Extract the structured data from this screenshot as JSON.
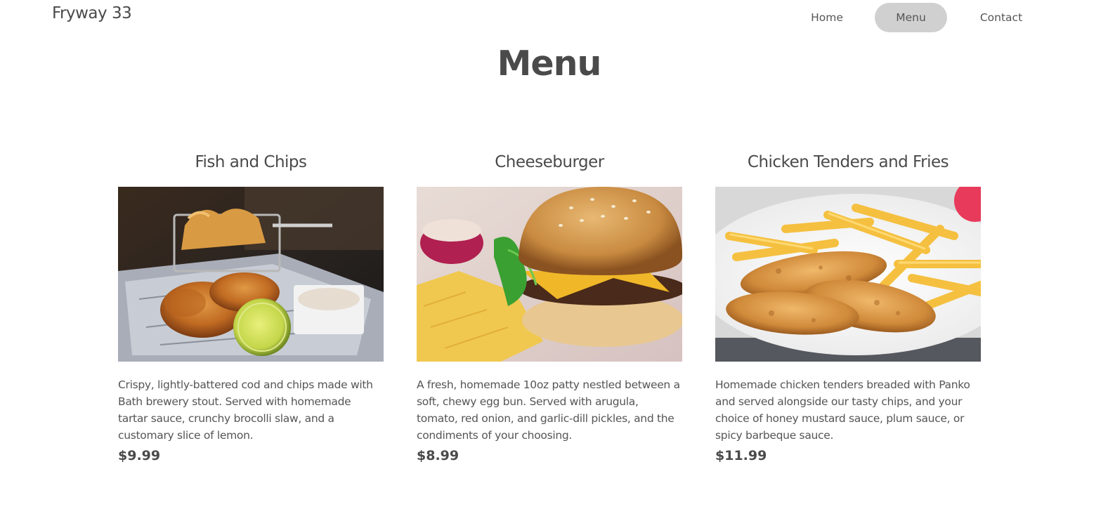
{
  "header": {
    "brand": "Fryway 33",
    "nav": [
      {
        "label": "Home",
        "active": false
      },
      {
        "label": "Menu",
        "active": true
      },
      {
        "label": "Contact",
        "active": false
      }
    ]
  },
  "page": {
    "title": "Menu"
  },
  "menu_items": [
    {
      "name": "Fish and Chips",
      "image": "fish-and-chips-photo",
      "description": "Crispy, lightly-battered cod and chips made with Bath brewery stout. Served with homemade tartar sauce, crunchy brocolli slaw, and a customary slice of lemon.",
      "price": "$9.99"
    },
    {
      "name": "Cheeseburger",
      "image": "cheeseburger-photo",
      "description": "A fresh, homemade 10oz patty nestled between a soft, chewy egg bun. Served with arugula, tomato, red onion, and garlic-dill pickles, and the condiments of your choosing.",
      "price": "$8.99"
    },
    {
      "name": "Chicken Tenders and Fries",
      "image": "chicken-tenders-photo",
      "description": "Homemade chicken tenders breaded with Panko and served alongside our tasty chips, and your choice of honey mustard sauce, plum sauce, or spicy barbeque sauce.",
      "price": "$11.99"
    }
  ],
  "colors": {
    "text": "#4a4a4a",
    "nav_active_bg": "#d0d0d0",
    "background": "#ffffff"
  }
}
